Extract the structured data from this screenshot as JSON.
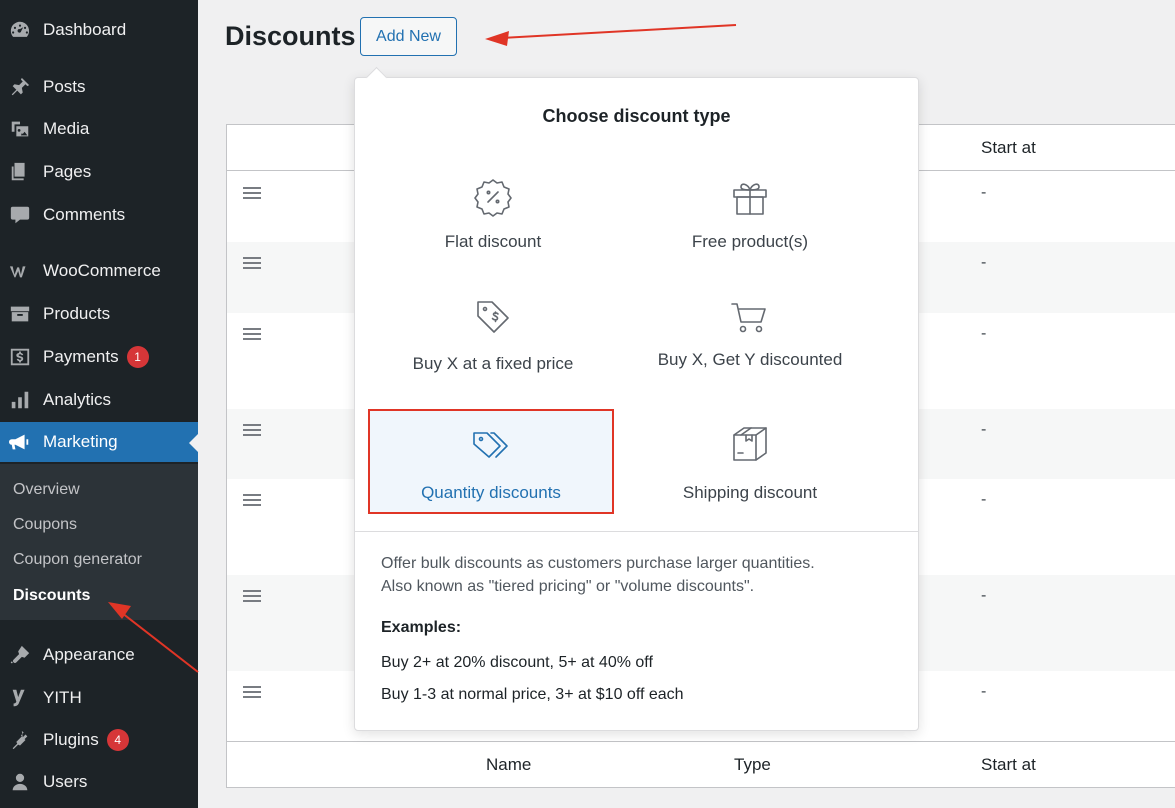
{
  "sidebar": {
    "items": [
      {
        "label": "Dashboard",
        "icon": "dashboard-icon"
      },
      {
        "label": "Posts",
        "icon": "pushpin-icon"
      },
      {
        "label": "Media",
        "icon": "media-icon"
      },
      {
        "label": "Pages",
        "icon": "pages-icon"
      },
      {
        "label": "Comments",
        "icon": "comment-icon"
      },
      {
        "label": "WooCommerce",
        "icon": "woocommerce-icon"
      },
      {
        "label": "Products",
        "icon": "archive-icon"
      },
      {
        "label": "Payments",
        "icon": "dollar-icon",
        "badge": "1"
      },
      {
        "label": "Analytics",
        "icon": "bar-chart-icon"
      },
      {
        "label": "Marketing",
        "icon": "megaphone-icon"
      },
      {
        "label": "Appearance",
        "icon": "paintbrush-icon"
      },
      {
        "label": "YITH",
        "icon": "yith-icon"
      },
      {
        "label": "Plugins",
        "icon": "plug-icon",
        "badge": "4"
      },
      {
        "label": "Users",
        "icon": "user-icon"
      }
    ],
    "submenu": [
      "Overview",
      "Coupons",
      "Coupon generator",
      "Discounts"
    ]
  },
  "page": {
    "title": "Discounts",
    "add_new_label": "Add New"
  },
  "table": {
    "header_start": "Start at",
    "footer": {
      "name": "Name",
      "type": "Type",
      "start": "Start at"
    },
    "row_value": "-"
  },
  "popover": {
    "title": "Choose discount type",
    "options": [
      {
        "label": "Flat discount",
        "icon": "percent-badge-icon"
      },
      {
        "label": "Free product(s)",
        "icon": "gift-icon"
      },
      {
        "label": "Buy X at a fixed price",
        "icon": "price-tag-dollar-icon"
      },
      {
        "label": "Buy X, Get Y discounted",
        "icon": "shopping-cart-icon"
      },
      {
        "label": "Quantity discounts",
        "icon": "tags-icon"
      },
      {
        "label": "Shipping discount",
        "icon": "box-icon"
      }
    ],
    "description_line1": "Offer bulk discounts as customers purchase larger quantities.",
    "description_line2": "Also known as \"tiered pricing\" or \"volume discounts\".",
    "examples_heading": "Examples:",
    "examples": [
      "Buy 2+ at 20% discount, 5+ at 40% off",
      "Buy 1-3 at normal price, 3+ at $10 off each"
    ]
  },
  "colors": {
    "sidebar_bg": "#1d2327",
    "active_bg": "#2271b1",
    "accent": "#2271b1",
    "highlight_red": "#e03526",
    "badge_red": "#d63638"
  }
}
